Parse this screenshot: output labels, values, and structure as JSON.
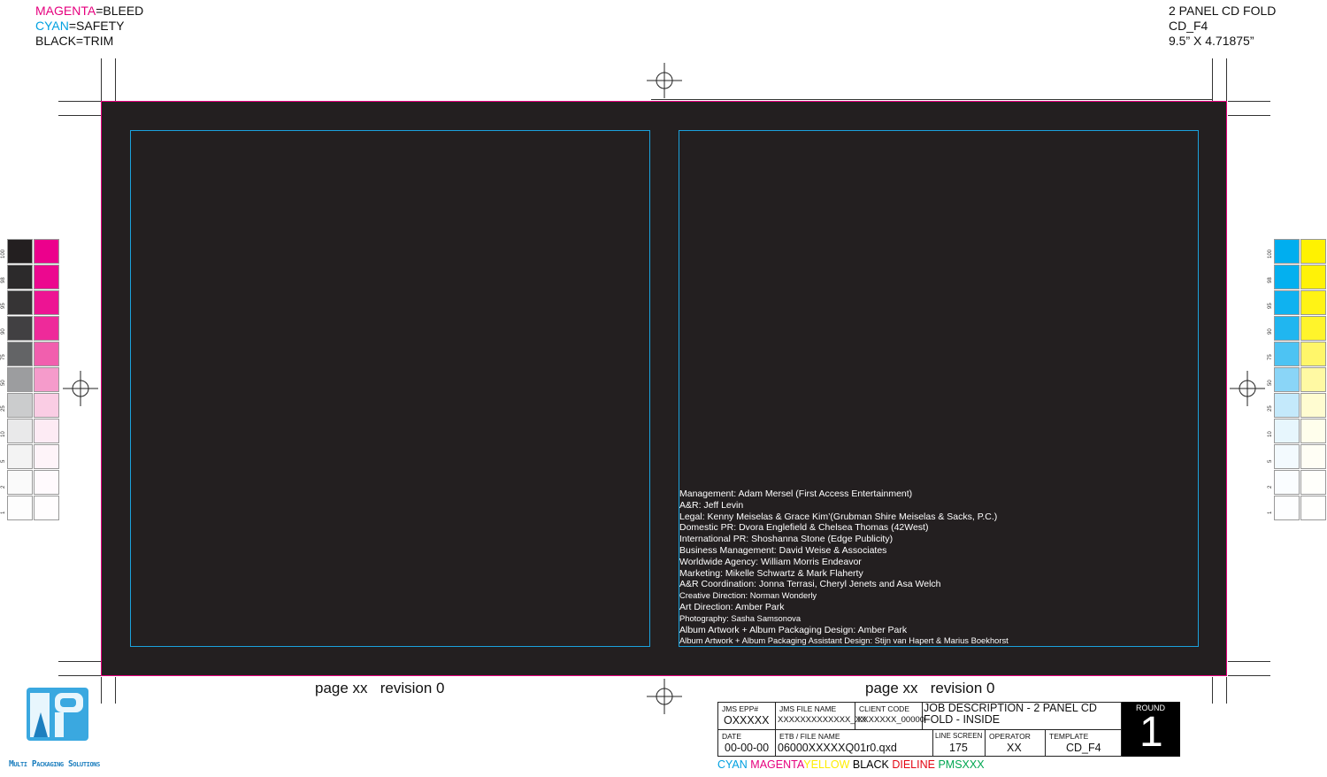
{
  "legend": {
    "magenta_word": "MAGENTA",
    "magenta_rest": "=BLEED",
    "cyan_word": "CYAN",
    "cyan_rest": "=SAFETY",
    "black_line": "BLACK=TRIM"
  },
  "spec": {
    "line1": "2 PANEL CD FOLD",
    "line2": "CD_F4",
    "line3": "9.5” X 4.71875”"
  },
  "credits": [
    "Management: Adam Mersel (First Access Entertainment)",
    "A&R: Jeff Levin",
    "Legal: Kenny Meiselas & Grace Kim’(Grubman Shire Meiselas & Sacks, P.C.)",
    "Domestic PR: Dvora Englefield & Chelsea Thomas (42West)",
    "International PR: Shoshanna Stone (Edge Publicity)",
    "Business Management: David Weise & Associates",
    "Worldwide Agency: William Morris Endeavor",
    "Marketing: Mikelle Schwartz & Mark Flaherty",
    "A&R Coordination: Jonna Terrasi, Cheryl Jenets and Asa Welch",
    "Creative Direction: Norman Wonderly",
    "Art Direction: Amber Park",
    "Photography: Sasha Samsonova",
    "Album Artwork + Album Packaging Design: Amber Park",
    "Album Artwork + Album Packaging Assistant Design: Stijn van Hapert & Marius Boekhorst"
  ],
  "page_labels": {
    "left": "page xx   revision 0",
    "right": "page xx   revision 0"
  },
  "swatch_ticks": [
    "100",
    "98",
    "95",
    "90",
    "75",
    "50",
    "25",
    "10",
    "5",
    "2",
    "1"
  ],
  "colors": {
    "magenta": "#e6007e",
    "cyan": "#00a0e0",
    "yellow": "#ffed00",
    "safety": "#1ba1dc",
    "board": "#231f20"
  },
  "title_block": {
    "jms_epp_hdr": "JMS EPP#",
    "jms_epp_val": "OXXXXX",
    "jms_file_hdr": "JMS FILE NAME",
    "jms_file_val": "XXXXXXXXXXXXX_XX",
    "client_hdr": "CLIENT CODE",
    "client_val": "XXXXXXX_00000",
    "job_desc": "JOB DESCRIPTION - 2 PANEL CD FOLD - INSIDE",
    "date_hdr": "DATE",
    "date_val": "00-00-00",
    "etb_hdr": "ETB / FILE NAME",
    "etb_val": "06000XXXXXQ01r0.qxd",
    "line_hdr": "LINE SCREEN",
    "line_val": "175",
    "op_hdr": "OPERATOR",
    "op_val": "XX",
    "tmpl_hdr": "TEMPLATE",
    "tmpl_val": "CD_F4",
    "round_hdr": "ROUND",
    "round_val": "1"
  },
  "inks": {
    "cyan": "CYAN",
    "magenta": "MAGENTA",
    "yellow": "YELLOW",
    "black": "BLACK",
    "dieline": "DIELINE",
    "pms": "PMSXXX"
  },
  "logo": {
    "text": "Multi Packaging Solutions"
  }
}
